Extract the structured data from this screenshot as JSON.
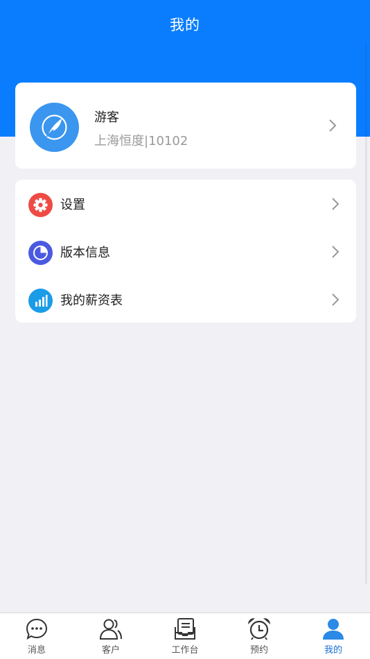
{
  "header": {
    "title": "我的"
  },
  "profile": {
    "name": "游客",
    "subtitle": "上海恒度|10102",
    "avatar_icon": "feather-icon"
  },
  "menu": {
    "items": [
      {
        "label": "设置",
        "icon": "gear-icon",
        "color": "#ee4b45"
      },
      {
        "label": "版本信息",
        "icon": "pie-chart-icon",
        "color": "#4a5ae0"
      },
      {
        "label": "我的薪资表",
        "icon": "bar-chart-icon",
        "color": "#1a9ce8"
      }
    ]
  },
  "tabbar": {
    "tabs": [
      {
        "label": "消息",
        "icon": "chat-bubble-icon"
      },
      {
        "label": "客户",
        "icon": "users-icon"
      },
      {
        "label": "工作台",
        "icon": "workbench-icon"
      },
      {
        "label": "预约",
        "icon": "alarm-clock-icon"
      },
      {
        "label": "我的",
        "icon": "person-icon",
        "active": true
      }
    ]
  },
  "colors": {
    "brand": "#0a7dff",
    "active_tab": "#1a6fd8",
    "background": "#f1f0f5"
  }
}
